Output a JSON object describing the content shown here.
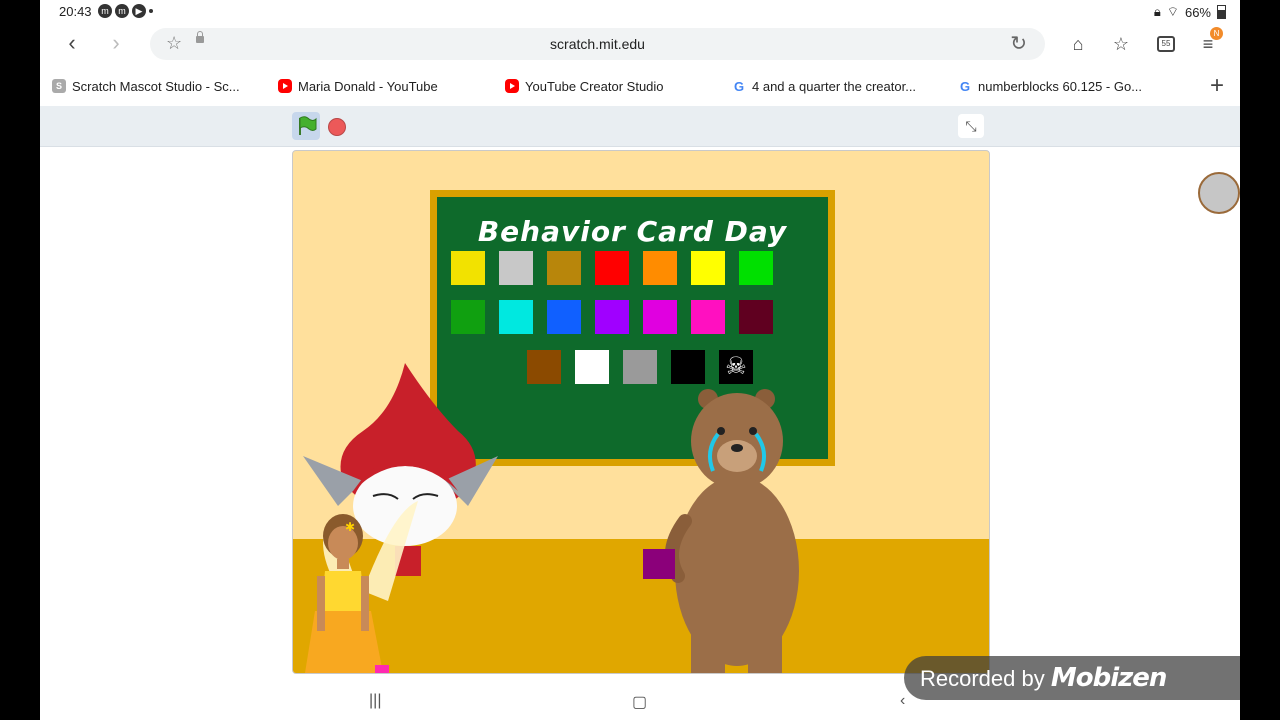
{
  "status_bar": {
    "time": "20:43",
    "battery": "66%"
  },
  "browser": {
    "url": "scratch.mit.edu",
    "menu_badge": "N",
    "tabs_count": "55",
    "tabs": [
      {
        "title": "Scratch Mascot Studio - Sc...",
        "favicon": "S"
      },
      {
        "title": "Maria Donald - YouTube",
        "favicon": "yt"
      },
      {
        "title": "YouTube Creator Studio",
        "favicon": "yt"
      },
      {
        "title": "4 and a quarter the creator...",
        "favicon": "G"
      },
      {
        "title": "numberblocks 60.125 - Go...",
        "favicon": "G"
      }
    ]
  },
  "stage": {
    "board_title": "Behavior Card Day",
    "card_rows": [
      [
        "#f2e200",
        "#c8c8c8",
        "#b8860b",
        "#ff0000",
        "#ff8c00",
        "#ffff00",
        "#00e000"
      ],
      [
        "#10a010",
        "#00e8e0",
        "#1060ff",
        "#a000ff",
        "#e000e0",
        "#ff10c0",
        "#600020"
      ],
      [
        "#8b4a00",
        "#ffffff",
        "#9a9a9a",
        "#000000",
        "skull"
      ]
    ],
    "held_card_color": "#8b007a"
  },
  "watermark": {
    "prefix": "Recorded by",
    "brand": "Mobizen"
  }
}
